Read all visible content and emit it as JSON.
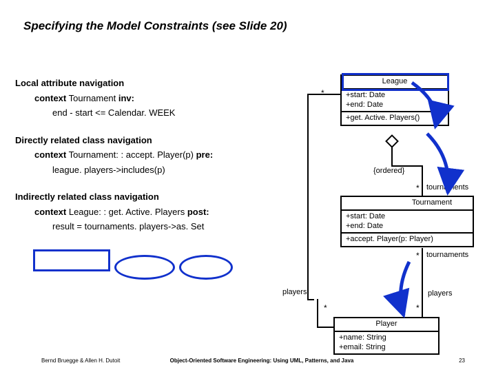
{
  "title": "Specifying the Model Constraints (see Slide 20)",
  "left": {
    "h1": "Local attribute navigation",
    "l1_context_kw": "context",
    "l1_context_rest": " Tournament ",
    "l1_inv_kw": "inv:",
    "l1_body": "end - start <= Calendar. WEEK",
    "h2": "Directly related class navigation",
    "l2_context_kw": "context",
    "l2_context_rest": " Tournament: : accept. Player(p) ",
    "l2_pre_kw": "pre:",
    "l2_body": "league. players->includes(p)",
    "h3": "Indirectly related class navigation",
    "l3_context_kw": "context",
    "l3_context_rest": " League: : get. Active. Players ",
    "l3_post_kw": "post:",
    "l3_body": "result = tournaments. players->as. Set"
  },
  "uml": {
    "league": {
      "name": "League",
      "attrs": "+start: Date\n+end: Date",
      "ops": "+get. Active. Players()"
    },
    "tournament": {
      "name": "Tournament",
      "attrs": "+start: Date\n+end: Date",
      "ops": "+accept. Player(p: Player)"
    },
    "player": {
      "name": "Player",
      "attrs": "+name: String\n+email: String"
    },
    "labels": {
      "ordered": "{ordered}",
      "tournaments": "tournaments",
      "players": "players",
      "star": "*"
    }
  },
  "footer": {
    "left": "Bernd Bruegge & Allen H. Dutoit",
    "center": "Object-Oriented Software Engineering: Using UML, Patterns, and Java",
    "page": "23"
  }
}
